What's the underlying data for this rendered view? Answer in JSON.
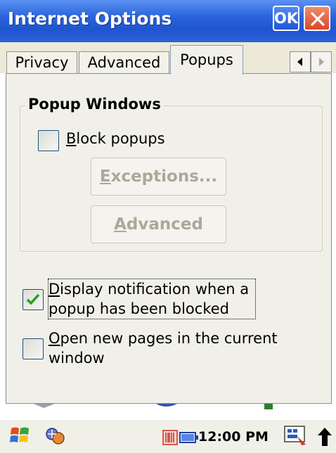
{
  "window": {
    "title": "Internet Options",
    "ok_label": "OK"
  },
  "tabs": [
    {
      "label": "Privacy",
      "active": false
    },
    {
      "label": "Advanced",
      "active": false
    },
    {
      "label": "Popups",
      "active": true
    }
  ],
  "popup_group": {
    "title": "Popup Windows",
    "block_popups": {
      "label_first": "B",
      "label_rest": "lock popups",
      "checked": false
    },
    "exceptions_button": {
      "mnemonic": "E",
      "rest": "xceptions..."
    },
    "advanced_button": {
      "mnemonic": "A",
      "rest": "dvanced"
    }
  },
  "options": {
    "display_notification": {
      "line1_first": "D",
      "line1_rest": "isplay notification when a",
      "line2": "popup has been blocked",
      "checked": true
    },
    "open_new_pages": {
      "line1_first": "O",
      "line1_rest": "pen new pages in the current",
      "line2": "window",
      "checked": false
    }
  },
  "taskbar": {
    "clock": "12:00 PM",
    "icons": [
      "start-flag-icon",
      "network-icon",
      "barcode-scanner-icon",
      "battery-icon",
      "keyboard-icon",
      "arrow-up-icon"
    ]
  },
  "colors": {
    "titlebar": "#2a63da",
    "panel": "#f1f0e8",
    "check_green": "#21a121",
    "disabled_text": "#aca899"
  }
}
